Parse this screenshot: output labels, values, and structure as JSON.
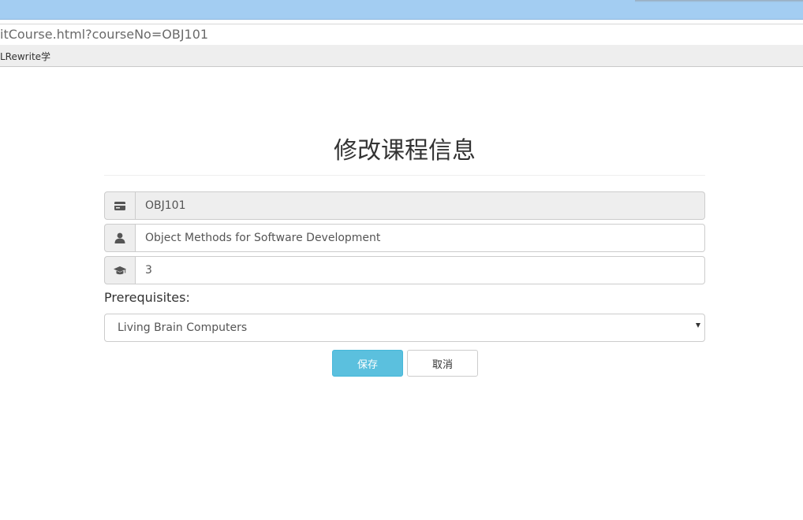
{
  "browser": {
    "url": "itCourse.html?courseNo=OBJ101",
    "bookmark": "LRewrite学"
  },
  "form": {
    "title": "修改课程信息",
    "course_no": "OBJ101",
    "course_name": "Object Methods for Software Development",
    "credit": "3",
    "prereq_label": "Prerequisites:",
    "prereq_selected": "Living Brain Computers",
    "save_label": "保存",
    "cancel_label": "取消"
  },
  "icons": {
    "course_no": "id-card-icon",
    "course_name": "user-icon",
    "credit": "graduation-cap-icon"
  },
  "colors": {
    "primary_button": "#5bc0de",
    "title_bar": "#a3cdf2"
  }
}
